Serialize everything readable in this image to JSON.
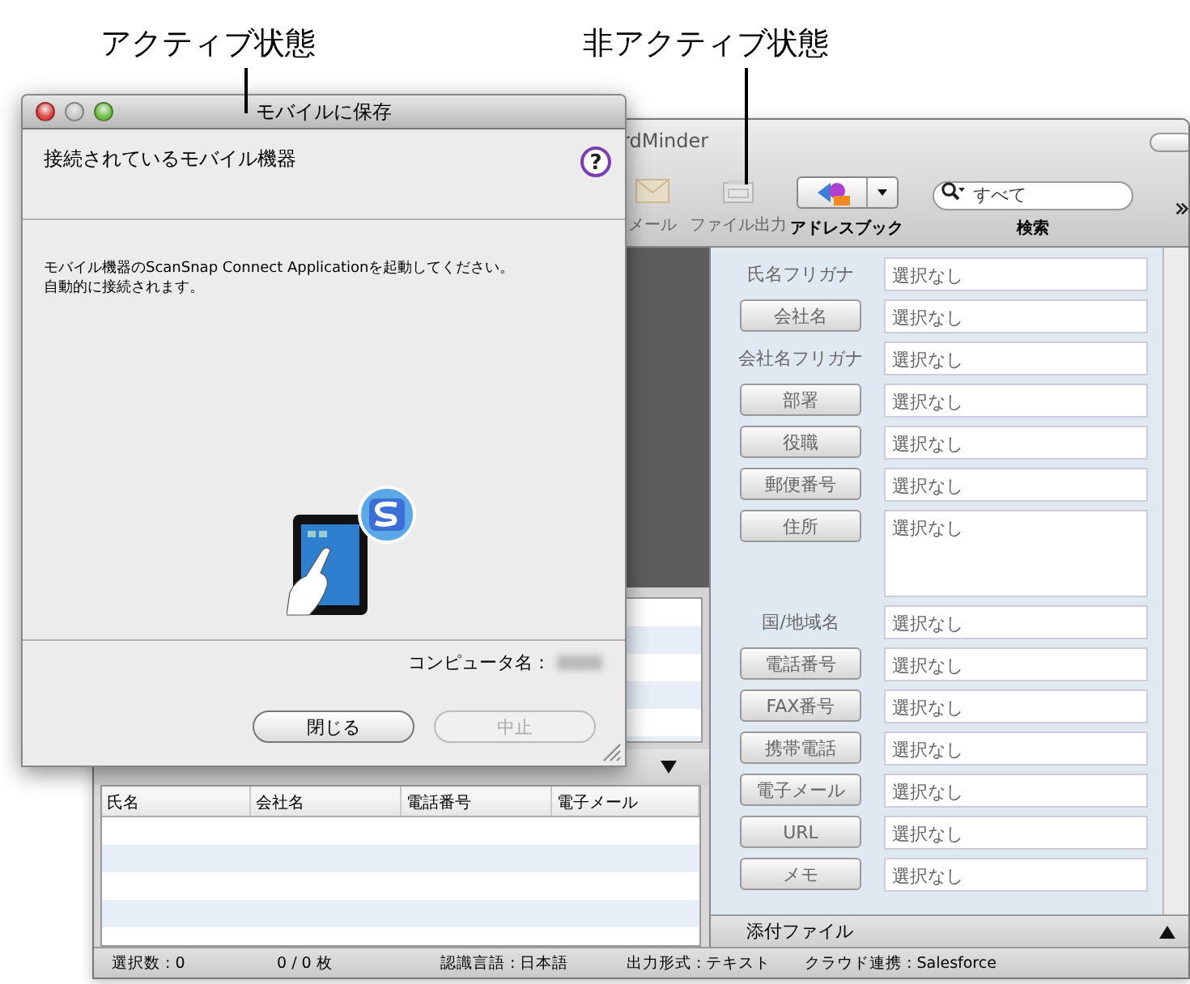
{
  "annotations": [
    {
      "text": "アクティブ状態"
    },
    {
      "text": "非アクティブ状態"
    }
  ],
  "dialog": {
    "title": "モバイルに保存",
    "active": true,
    "heading": "接続されているモバイル機器",
    "help": "?",
    "message": [
      "モバイル機器のScanSnap Connect Applicationを起動してください。",
      "自動的に接続されます。"
    ],
    "computer_label": "コンピュータ名：",
    "buttons": [
      {
        "label": "閉じる",
        "disabled": false
      },
      {
        "label": "中止",
        "disabled": true
      }
    ]
  },
  "main_window": {
    "title": "rdMinder",
    "active": false,
    "toolbar": [
      {
        "kind": "mail",
        "label": "メール",
        "disabled": true
      },
      {
        "kind": "export",
        "label": "ファイル出力",
        "disabled": true
      },
      {
        "kind": "addressbook",
        "label": "アドレスブック",
        "disabled": false
      }
    ],
    "search": {
      "placeholder": "すべて",
      "label": "検索"
    },
    "fields": [
      {
        "label": "氏名フリガナ",
        "kind": "label",
        "value": "選択なし",
        "multiline": false
      },
      {
        "label": "会社名",
        "kind": "button",
        "value": "選択なし",
        "multiline": false
      },
      {
        "label": "会社名フリガナ",
        "kind": "label",
        "value": "選択なし",
        "multiline": false
      },
      {
        "label": "部署",
        "kind": "button",
        "value": "選択なし",
        "multiline": false
      },
      {
        "label": "役職",
        "kind": "button",
        "value": "選択なし",
        "multiline": false
      },
      {
        "label": "郵便番号",
        "kind": "button",
        "value": "選択なし",
        "multiline": false
      },
      {
        "label": "住所",
        "kind": "button",
        "value": "選択なし",
        "multiline": true
      },
      {
        "label": "国/地域名",
        "kind": "label",
        "value": "選択なし",
        "multiline": false
      },
      {
        "label": "電話番号",
        "kind": "button",
        "value": "選択なし",
        "multiline": false
      },
      {
        "label": "FAX番号",
        "kind": "button",
        "value": "選択なし",
        "multiline": false
      },
      {
        "label": "携帯電話",
        "kind": "button",
        "value": "選択なし",
        "multiline": false
      },
      {
        "label": "電子メール",
        "kind": "button",
        "value": "選択なし",
        "multiline": false
      },
      {
        "label": "URL",
        "kind": "button",
        "value": "選択なし",
        "multiline": false
      },
      {
        "label": "メモ",
        "kind": "button",
        "value": "選択なし",
        "multiline": false
      }
    ],
    "attachments": "添付ファイル",
    "list": {
      "columns": [
        "氏名",
        "会社名",
        "電話番号",
        "電子メール"
      ]
    },
    "status_bar": [
      "選択数 : 0",
      "0 / 0 枚",
      "認識言語 : 日本語",
      "出力形式 : テキスト",
      "クラウド連携 : Salesforce"
    ]
  }
}
